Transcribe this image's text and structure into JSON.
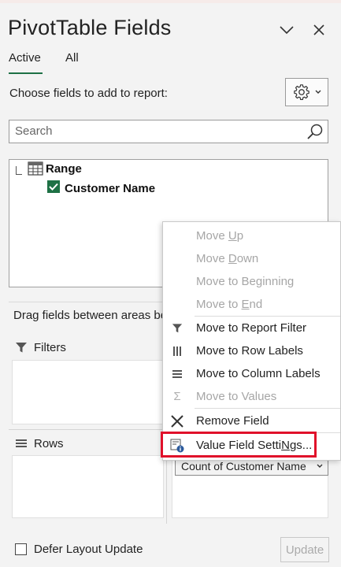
{
  "panel": {
    "title": "PivotTable Fields",
    "tabs": [
      "Active",
      "All"
    ],
    "active_tab": "Active",
    "choose_label": "Choose fields to add to report:",
    "search_placeholder": "Search",
    "accent_color": "#1e7145"
  },
  "field_list": {
    "group_label": "Range",
    "fields": [
      {
        "label": "Customer Name",
        "checked": true
      }
    ]
  },
  "areas": {
    "instruction": "Drag fields between areas be",
    "filters_label": "Filters",
    "rows_label": "Rows",
    "values_pill": "Count of Customer Name"
  },
  "footer": {
    "defer_label": "Defer Layout Update",
    "defer_checked": false,
    "update_label": "Update"
  },
  "context_menu": {
    "items": [
      {
        "label": "Move Up",
        "access_key": "U",
        "enabled": false,
        "icon": ""
      },
      {
        "label": "Move Down",
        "access_key": "D",
        "enabled": false,
        "icon": ""
      },
      {
        "label": "Move to Beginning",
        "access_key": "g",
        "enabled": false,
        "icon": ""
      },
      {
        "label": "Move to End",
        "access_key": "E",
        "enabled": false,
        "icon": ""
      },
      {
        "label": "Move to Report Filter",
        "enabled": true,
        "icon": "filter-icon"
      },
      {
        "label": "Move to Row Labels",
        "enabled": true,
        "icon": "row-labels-icon"
      },
      {
        "label": "Move to Column Labels",
        "enabled": true,
        "icon": "column-labels-icon"
      },
      {
        "label": "Move to Values",
        "enabled": false,
        "icon": "sigma-icon"
      },
      {
        "label": "Remove Field",
        "enabled": true,
        "icon": "remove-x-icon"
      },
      {
        "label": "Value Field Settings...",
        "access_key": "N",
        "enabled": true,
        "icon": "field-settings-icon",
        "highlighted": true
      }
    ],
    "highlight_color": "#e0102a"
  }
}
